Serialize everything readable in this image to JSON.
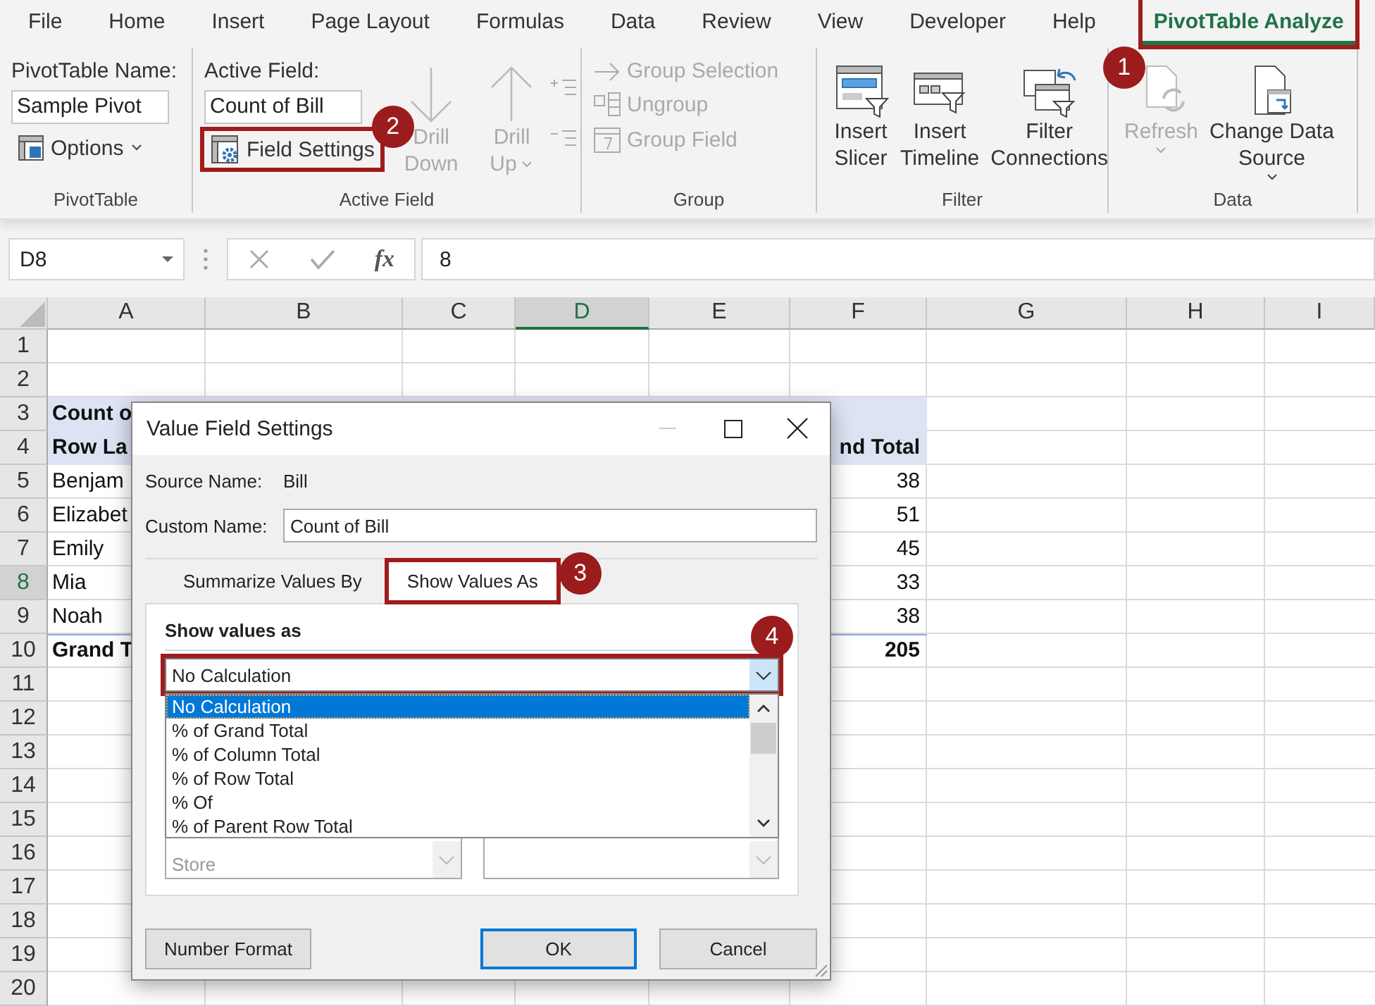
{
  "ribbon_tabs": [
    {
      "label": "File",
      "selected": false
    },
    {
      "label": "Home",
      "selected": false
    },
    {
      "label": "Insert",
      "selected": false
    },
    {
      "label": "Page Layout",
      "selected": false
    },
    {
      "label": "Formulas",
      "selected": false
    },
    {
      "label": "Data",
      "selected": false
    },
    {
      "label": "Review",
      "selected": false
    },
    {
      "label": "View",
      "selected": false
    },
    {
      "label": "Developer",
      "selected": false
    },
    {
      "label": "Help",
      "selected": false
    },
    {
      "label": "PivotTable Analyze",
      "selected": true,
      "callout": "1"
    }
  ],
  "ribbon": {
    "pivottable": {
      "name_label": "PivotTable Name:",
      "name_value": "Sample Pivot",
      "options": "Options",
      "group_label": "PivotTable"
    },
    "active_field": {
      "field_label": "Active Field:",
      "field_value": "Count of Bill",
      "field_settings": {
        "label": "Field Settings",
        "callout": "2"
      },
      "drill_buttons": [
        {
          "lines": [
            "Drill",
            "Down"
          ],
          "disabled": true,
          "caret": false
        },
        {
          "lines": [
            "Drill",
            "Up"
          ],
          "disabled": true,
          "caret": true
        }
      ],
      "expand_disabled": true,
      "group_label": "Active Field"
    },
    "group": {
      "items": [
        {
          "label": "Group Selection",
          "disabled": true
        },
        {
          "label": "Ungroup",
          "disabled": true
        },
        {
          "label": "Group Field",
          "disabled": true
        }
      ],
      "group_label": "Group"
    },
    "filter": {
      "buttons": [
        {
          "lines": [
            "Insert",
            "Slicer"
          ]
        },
        {
          "lines": [
            "Insert",
            "Timeline"
          ]
        },
        {
          "lines": [
            "Filter",
            "Connections"
          ]
        }
      ],
      "group_label": "Filter"
    },
    "data": {
      "buttons": [
        {
          "lines": [
            "Refresh"
          ],
          "disabled": true
        },
        {
          "lines": [
            "Change Data",
            "Source"
          ],
          "disabled": false
        }
      ],
      "group_label": "Data"
    }
  },
  "formula_bar": {
    "name_box": "D8",
    "function_symbol": "fx",
    "formula": "8"
  },
  "sheet": {
    "columns": [
      {
        "label": "A",
        "selected": false
      },
      {
        "label": "B",
        "selected": false
      },
      {
        "label": "C",
        "selected": false
      },
      {
        "label": "D",
        "selected": true
      },
      {
        "label": "E",
        "selected": false
      },
      {
        "label": "F",
        "selected": false
      },
      {
        "label": "G",
        "selected": false
      },
      {
        "label": "H",
        "selected": false
      },
      {
        "label": "I",
        "selected": false
      }
    ],
    "rows": [
      {
        "label": "1",
        "selected": false
      },
      {
        "label": "2",
        "selected": false
      },
      {
        "label": "3",
        "selected": false
      },
      {
        "label": "4",
        "selected": false
      },
      {
        "label": "5",
        "selected": false
      },
      {
        "label": "6",
        "selected": false
      },
      {
        "label": "7",
        "selected": false
      },
      {
        "label": "8",
        "selected": true
      },
      {
        "label": "9",
        "selected": false
      },
      {
        "label": "10",
        "selected": false
      },
      {
        "label": "11",
        "selected": false
      },
      {
        "label": "12",
        "selected": false
      },
      {
        "label": "13",
        "selected": false
      },
      {
        "label": "14",
        "selected": false
      },
      {
        "label": "15",
        "selected": false
      },
      {
        "label": "16",
        "selected": false
      },
      {
        "label": "17",
        "selected": false
      },
      {
        "label": "18",
        "selected": false
      },
      {
        "label": "19",
        "selected": false
      },
      {
        "label": "20",
        "selected": false
      }
    ],
    "pivot": {
      "title": "Count o",
      "headers": [
        "Row La",
        "nd Total"
      ],
      "rows": [
        {
          "label": "Benjam",
          "value": "38"
        },
        {
          "label": "Elizabet",
          "value": "51"
        },
        {
          "label": "Emily",
          "value": "45"
        },
        {
          "label": "Mia",
          "value": "33"
        },
        {
          "label": "Noah",
          "value": "38"
        }
      ],
      "total": {
        "label": "Grand T",
        "value": "205"
      }
    }
  },
  "dialog": {
    "title": "Value Field Settings",
    "source_label": "Source Name:",
    "source_value": "Bill",
    "custom_label": "Custom Name:",
    "custom_value": "Count of Bill",
    "tabs": [
      {
        "label": "Summarize Values By",
        "selected": false
      },
      {
        "label": "Show Values As",
        "selected": true,
        "callout": "3"
      }
    ],
    "section_label": "Show values as",
    "dropdown": {
      "value": "No Calculation",
      "callout": "4",
      "options": [
        {
          "label": "No Calculation",
          "selected": true
        },
        {
          "label": "% of Grand Total",
          "selected": false
        },
        {
          "label": "% of Column Total",
          "selected": false
        },
        {
          "label": "% of Row Total",
          "selected": false
        },
        {
          "label": "% Of",
          "selected": false
        },
        {
          "label": "% of Parent Row Total",
          "selected": false
        }
      ]
    },
    "base_items": [
      "Store"
    ],
    "buttons": [
      {
        "label": "Number Format",
        "default": false
      },
      {
        "label": "OK",
        "default": true
      },
      {
        "label": "Cancel",
        "default": false
      }
    ]
  }
}
